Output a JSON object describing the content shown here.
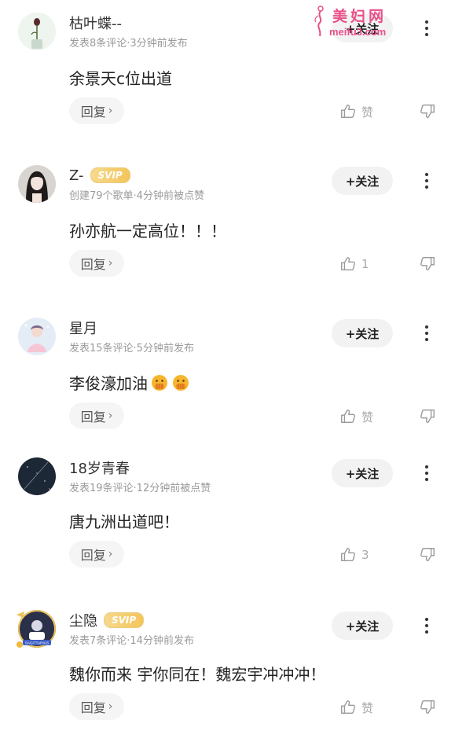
{
  "watermark": {
    "text": "美妇网",
    "url": "meifu3.com"
  },
  "comments": [
    {
      "username": "枯叶蝶--",
      "svip": "",
      "meta": "发表8条评论·3分钟前发布",
      "follow_label": "+关注",
      "content": "余景天c位出道",
      "reply_label": "回复",
      "like_label": "赞",
      "avatar_icon": "plant-avatar"
    },
    {
      "username": "Z-",
      "svip": "SVIP",
      "meta": "创建79个歌单·4分钟前被点赞",
      "follow_label": "+关注",
      "content": "孙亦航一定高位！！！",
      "reply_label": "回复",
      "like_label": "1",
      "avatar_icon": "girl-portrait-avatar"
    },
    {
      "username": "星月",
      "svip": "",
      "meta": "发表15条评论·5分钟前发布",
      "follow_label": "+关注",
      "content": "李俊濠加油",
      "reply_label": "回复",
      "like_label": "赞",
      "avatar_icon": "illustration-avatar"
    },
    {
      "username": "18岁青春",
      "svip": "",
      "meta": "发表19条评论·12分钟前被点赞",
      "follow_label": "+关注",
      "content": "唐九洲出道吧！",
      "reply_label": "回复",
      "like_label": "3",
      "avatar_icon": "night-sky-avatar"
    },
    {
      "username": "尘隐",
      "svip": "SVIP",
      "meta": "发表7条评论·14分钟前发布",
      "follow_label": "+关注",
      "content": "魏你而来 宇你同在！魏宏宇冲冲冲！",
      "reply_label": "回复",
      "like_label": "赞",
      "avatar_icon": "sagittarius-avatar",
      "avatar_text": "SAGITTARIUS"
    }
  ],
  "colors": {
    "svip_gold": "#f3c55a",
    "meta_gray": "#9a9a9a",
    "watermark_pink": "#e8508a"
  }
}
